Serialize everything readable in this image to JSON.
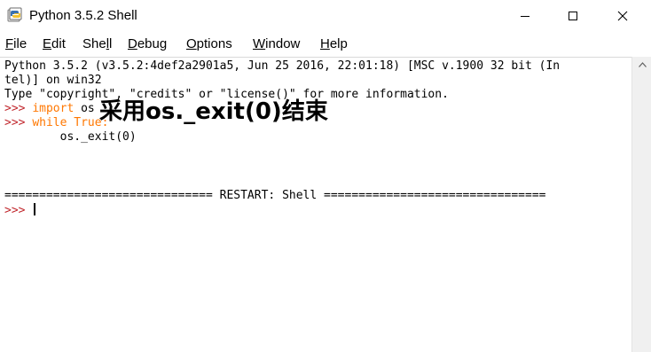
{
  "window": {
    "title": "Python 3.5.2 Shell"
  },
  "menu": {
    "items": [
      {
        "label": "File",
        "acc": "F",
        "rest": "ile"
      },
      {
        "label": "Edit",
        "acc": "E",
        "rest": "dit"
      },
      {
        "label": "Shell",
        "pre": "She",
        "acc": "l",
        "rest": "l"
      },
      {
        "label": "Debug",
        "acc": "D",
        "rest": "ebug"
      },
      {
        "label": "Options",
        "acc": "O",
        "rest": "ptions"
      },
      {
        "label": "Window",
        "acc": "W",
        "rest": "indow"
      },
      {
        "label": "Help",
        "acc": "H",
        "rest": "elp"
      }
    ]
  },
  "shell": {
    "banner_line1": "Python 3.5.2 (v3.5.2:4def2a2901a5, Jun 25 2016, 22:01:18) [MSC v.1900 32 bit (In",
    "banner_line2": "tel)] on win32",
    "banner_line3": "Type \"copyright\", \"credits\" or \"license()\" for more information.",
    "prompt": ">>> ",
    "cmd1_keyword": "import",
    "cmd1_rest": " os",
    "cmd2_keyword": "while",
    "cmd2_space": " ",
    "cmd2_value": "True",
    "cmd2_colon": ":",
    "cmd3": "        os._exit(0)",
    "restart_line": "============================== RESTART: Shell ================================"
  },
  "annotation": {
    "text": "采用os._exit(0)结束"
  },
  "colors": {
    "prompt": "#c1272d",
    "keyword": "#ff7700",
    "text": "#000000"
  }
}
